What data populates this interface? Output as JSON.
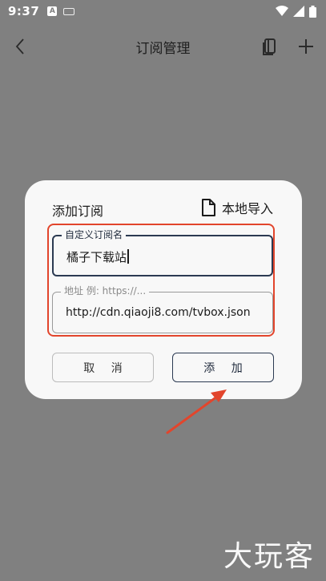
{
  "status_bar": {
    "time": "9:37",
    "badge": "A"
  },
  "app_bar": {
    "title": "订阅管理"
  },
  "dialog": {
    "title": "添加订阅",
    "import_label": "本地导入",
    "name_field": {
      "label": "自定义订阅名",
      "value": "橘子下载站"
    },
    "url_field": {
      "label": "地址 例: https://...",
      "value": "http://cdn.qiaoji8.com/tvbox.json"
    },
    "cancel_label": "取 消",
    "add_label": "添 加"
  },
  "watermark": "大玩客",
  "colors": {
    "highlight": "#e2452c",
    "accent": "#2b3a52",
    "overlay": "#808080"
  }
}
